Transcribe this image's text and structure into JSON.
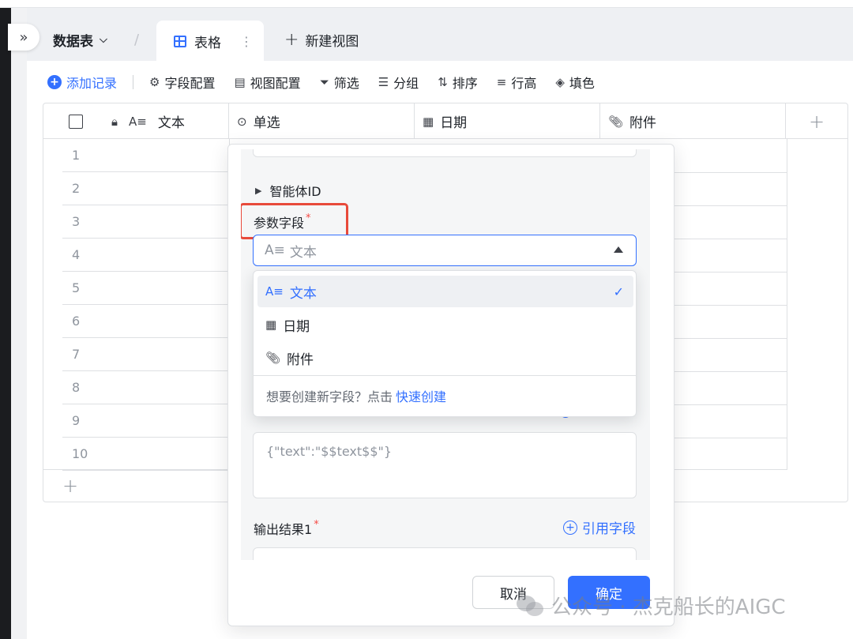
{
  "nav": {
    "collapse_glyph": "»",
    "table_name": "数据表",
    "tab_label": "表格",
    "tab_more": "⋮",
    "new_view_label": "新建视图"
  },
  "toolbar": {
    "add_record": "添加记录",
    "field_config": "字段配置",
    "view_config": "视图配置",
    "filter": "筛选",
    "group": "分组",
    "sort": "排序",
    "row_height": "行高",
    "fill_color": "填色"
  },
  "grid": {
    "columns": [
      {
        "label": "文本",
        "icon": "text-type-icon"
      },
      {
        "label": "单选",
        "icon": "single-select-icon"
      },
      {
        "label": "日期",
        "icon": "calendar-icon"
      },
      {
        "label": "附件",
        "icon": "paperclip-icon"
      }
    ],
    "rows": [
      "1",
      "2",
      "3",
      "4",
      "5",
      "6",
      "7",
      "8",
      "9",
      "10"
    ]
  },
  "panel": {
    "agent_id_label": "智能体ID",
    "param_field_label": "参数字段",
    "required_mark": "*",
    "select_placeholder": "文本",
    "request_body_placeholder": "{\"text\":\"$$text$$\"}",
    "output_label": "输出结果1",
    "reference_field": "引用字段",
    "cancel_button": "取消",
    "confirm_button": "确定"
  },
  "dropdown": {
    "options": [
      {
        "label": "文本",
        "icon": "text-type-icon",
        "selected": true
      },
      {
        "label": "日期",
        "icon": "calendar-icon",
        "selected": false
      },
      {
        "label": "附件",
        "icon": "paperclip-icon",
        "selected": false
      }
    ],
    "footer_text": "想要创建新字段？点击",
    "footer_link": "快速创建"
  },
  "watermark": {
    "text": "公众号 · 杰克船长的AIGC"
  },
  "colors": {
    "accent": "#3370ff",
    "highlight_box": "#e84a3b",
    "required": "#f54a45"
  }
}
